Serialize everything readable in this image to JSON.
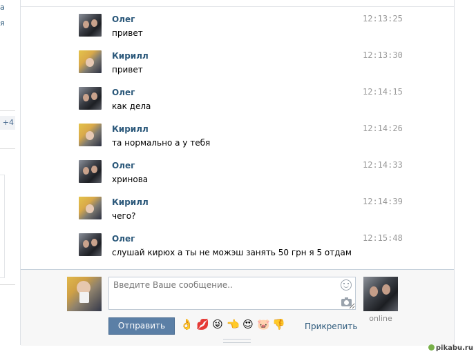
{
  "left_fragment": {
    "badge": "+4"
  },
  "messages": [
    {
      "author": "Олег",
      "avatar": "oleg",
      "text": "привет",
      "time": "12:13:25"
    },
    {
      "author": "Кирилл",
      "avatar": "kirill",
      "text": "привет",
      "time": "12:13:30"
    },
    {
      "author": "Олег",
      "avatar": "oleg",
      "text": "как дела",
      "time": "12:14:15"
    },
    {
      "author": "Кирилл",
      "avatar": "kirill",
      "text": "та нормально а у тебя",
      "time": "12:14:26"
    },
    {
      "author": "Олег",
      "avatar": "oleg",
      "text": "хринова",
      "time": "12:14:33"
    },
    {
      "author": "Кирилл",
      "avatar": "kirill",
      "text": "чего?",
      "time": "12:14:39"
    },
    {
      "author": "Олег",
      "avatar": "oleg",
      "text": "слушай кирюх а ты не можэш занять 50 грн я 5 отдам",
      "time": "12:15:48"
    }
  ],
  "composer": {
    "placeholder": "Введите Ваше сообщение..",
    "send_label": "Отправить",
    "attach_label": "Прикрепить",
    "peer_status": "online",
    "emojis": [
      "👌",
      "💋",
      "😜",
      "👈",
      "😍",
      "🐷",
      "👎"
    ]
  },
  "watermark": "pikabu.ru",
  "colors": {
    "link": "#2b587a",
    "button": "#5b7fa6",
    "time": "#999999"
  }
}
